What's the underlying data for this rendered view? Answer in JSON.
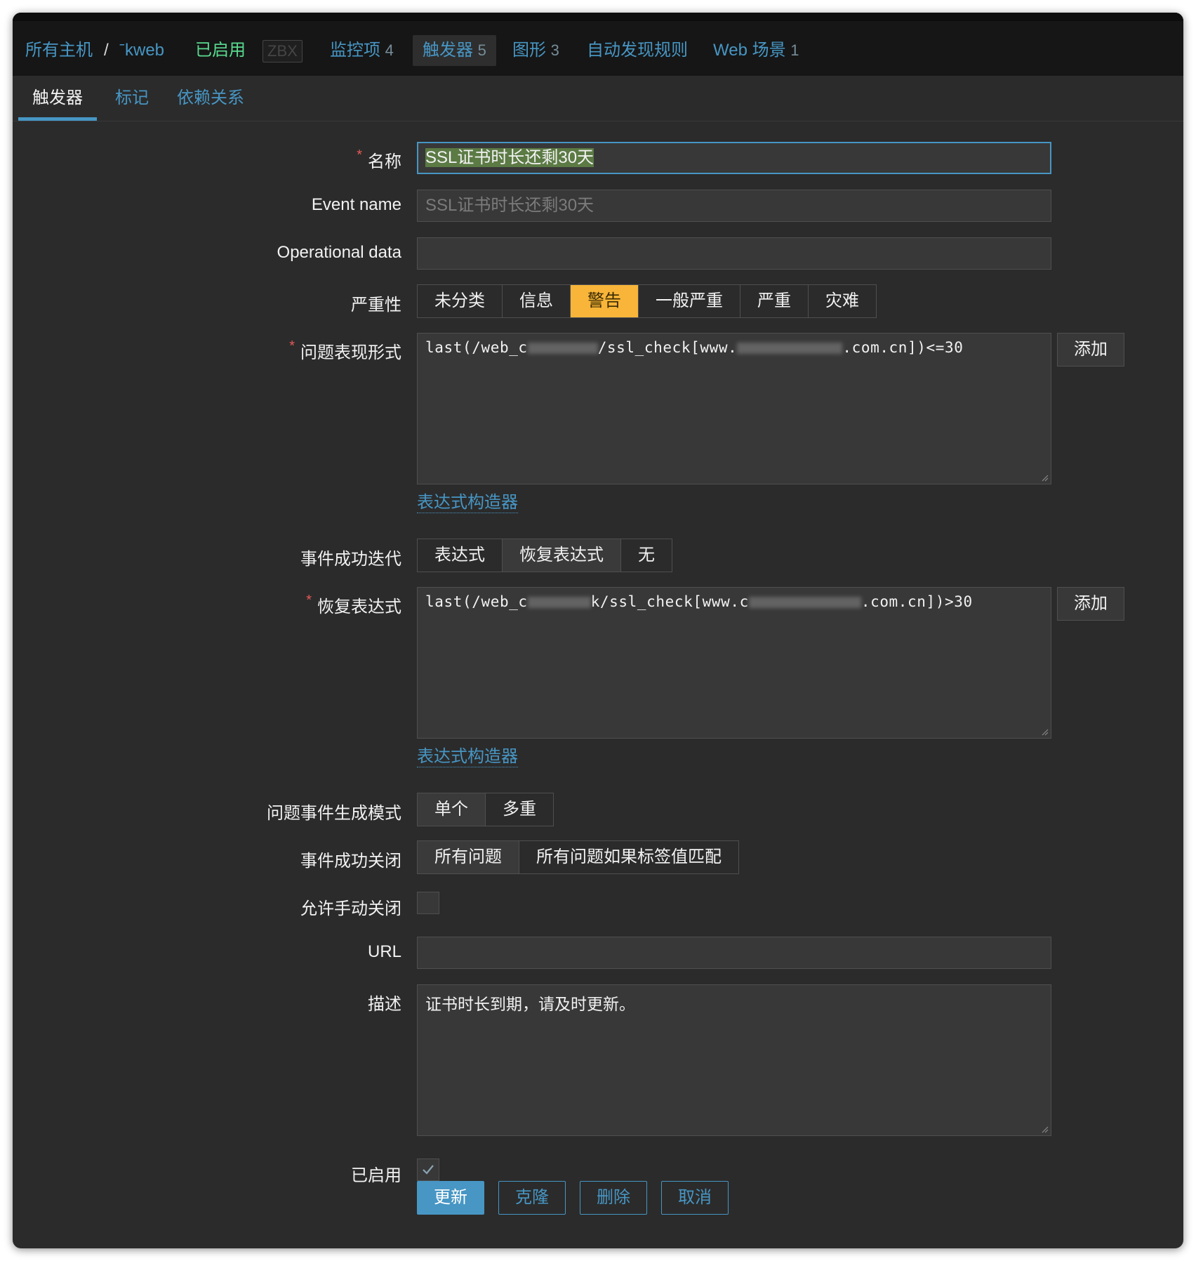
{
  "top_nav": {
    "all_hosts": "所有主机",
    "separator": "/",
    "host": "ˉkweb",
    "status": "已启用",
    "zbx": "ZBX",
    "items": {
      "label": "监控项",
      "count": "4"
    },
    "triggers": {
      "label": "触发器",
      "count": "5"
    },
    "graphs": {
      "label": "图形",
      "count": "3"
    },
    "discovery": "自动发现规则",
    "web": {
      "label": "Web 场景",
      "count": "1"
    }
  },
  "tabs": [
    "触发器",
    "标记",
    "依赖关系"
  ],
  "form": {
    "name": {
      "label": "名称",
      "value": "SSL证书时长还剩30天"
    },
    "event_name": {
      "label": "Event name",
      "placeholder": "SSL证书时长还剩30天"
    },
    "operational_data": {
      "label": "Operational data",
      "value": ""
    },
    "severity": {
      "label": "严重性",
      "options": [
        "未分类",
        "信息",
        "警告",
        "一般严重",
        "严重",
        "灾难"
      ],
      "selected": "警告"
    },
    "problem_expression": {
      "label": "问题表现形式",
      "value_start": "last(/web_c",
      "value_mid": "/ssl_check[www.",
      "value_end": ".com.cn])<=30",
      "add_button": "添加",
      "builder_link": "表达式构造器"
    },
    "recovery_mode": {
      "label": "事件成功迭代",
      "options": [
        "表达式",
        "恢复表达式",
        "无"
      ],
      "selected": "恢复表达式"
    },
    "recovery_expression": {
      "label": "恢复表达式",
      "value_start": "last(/web_c",
      "value_mid": "k/ssl_check[www.c",
      "value_end": ".com.cn])>30",
      "add_button": "添加",
      "builder_link": "表达式构造器"
    },
    "event_generation": {
      "label": "问题事件生成模式",
      "options": [
        "单个",
        "多重"
      ],
      "selected": "单个"
    },
    "ok_event_closes": {
      "label": "事件成功关闭",
      "options": [
        "所有问题",
        "所有问题如果标签值匹配"
      ],
      "selected": "所有问题"
    },
    "manual_close": {
      "label": "允许手动关闭",
      "checked": false
    },
    "url": {
      "label": "URL",
      "value": ""
    },
    "description": {
      "label": "描述",
      "value": "证书时长到期，请及时更新。"
    },
    "enabled": {
      "label": "已启用",
      "checked": true
    }
  },
  "actions": {
    "update": "更新",
    "clone": "克隆",
    "delete": "删除",
    "cancel": "取消"
  },
  "colors": {
    "accent": "#4796c4",
    "warning": "#f8b539",
    "required": "#e45959",
    "enabled_status": "#59db8f"
  }
}
